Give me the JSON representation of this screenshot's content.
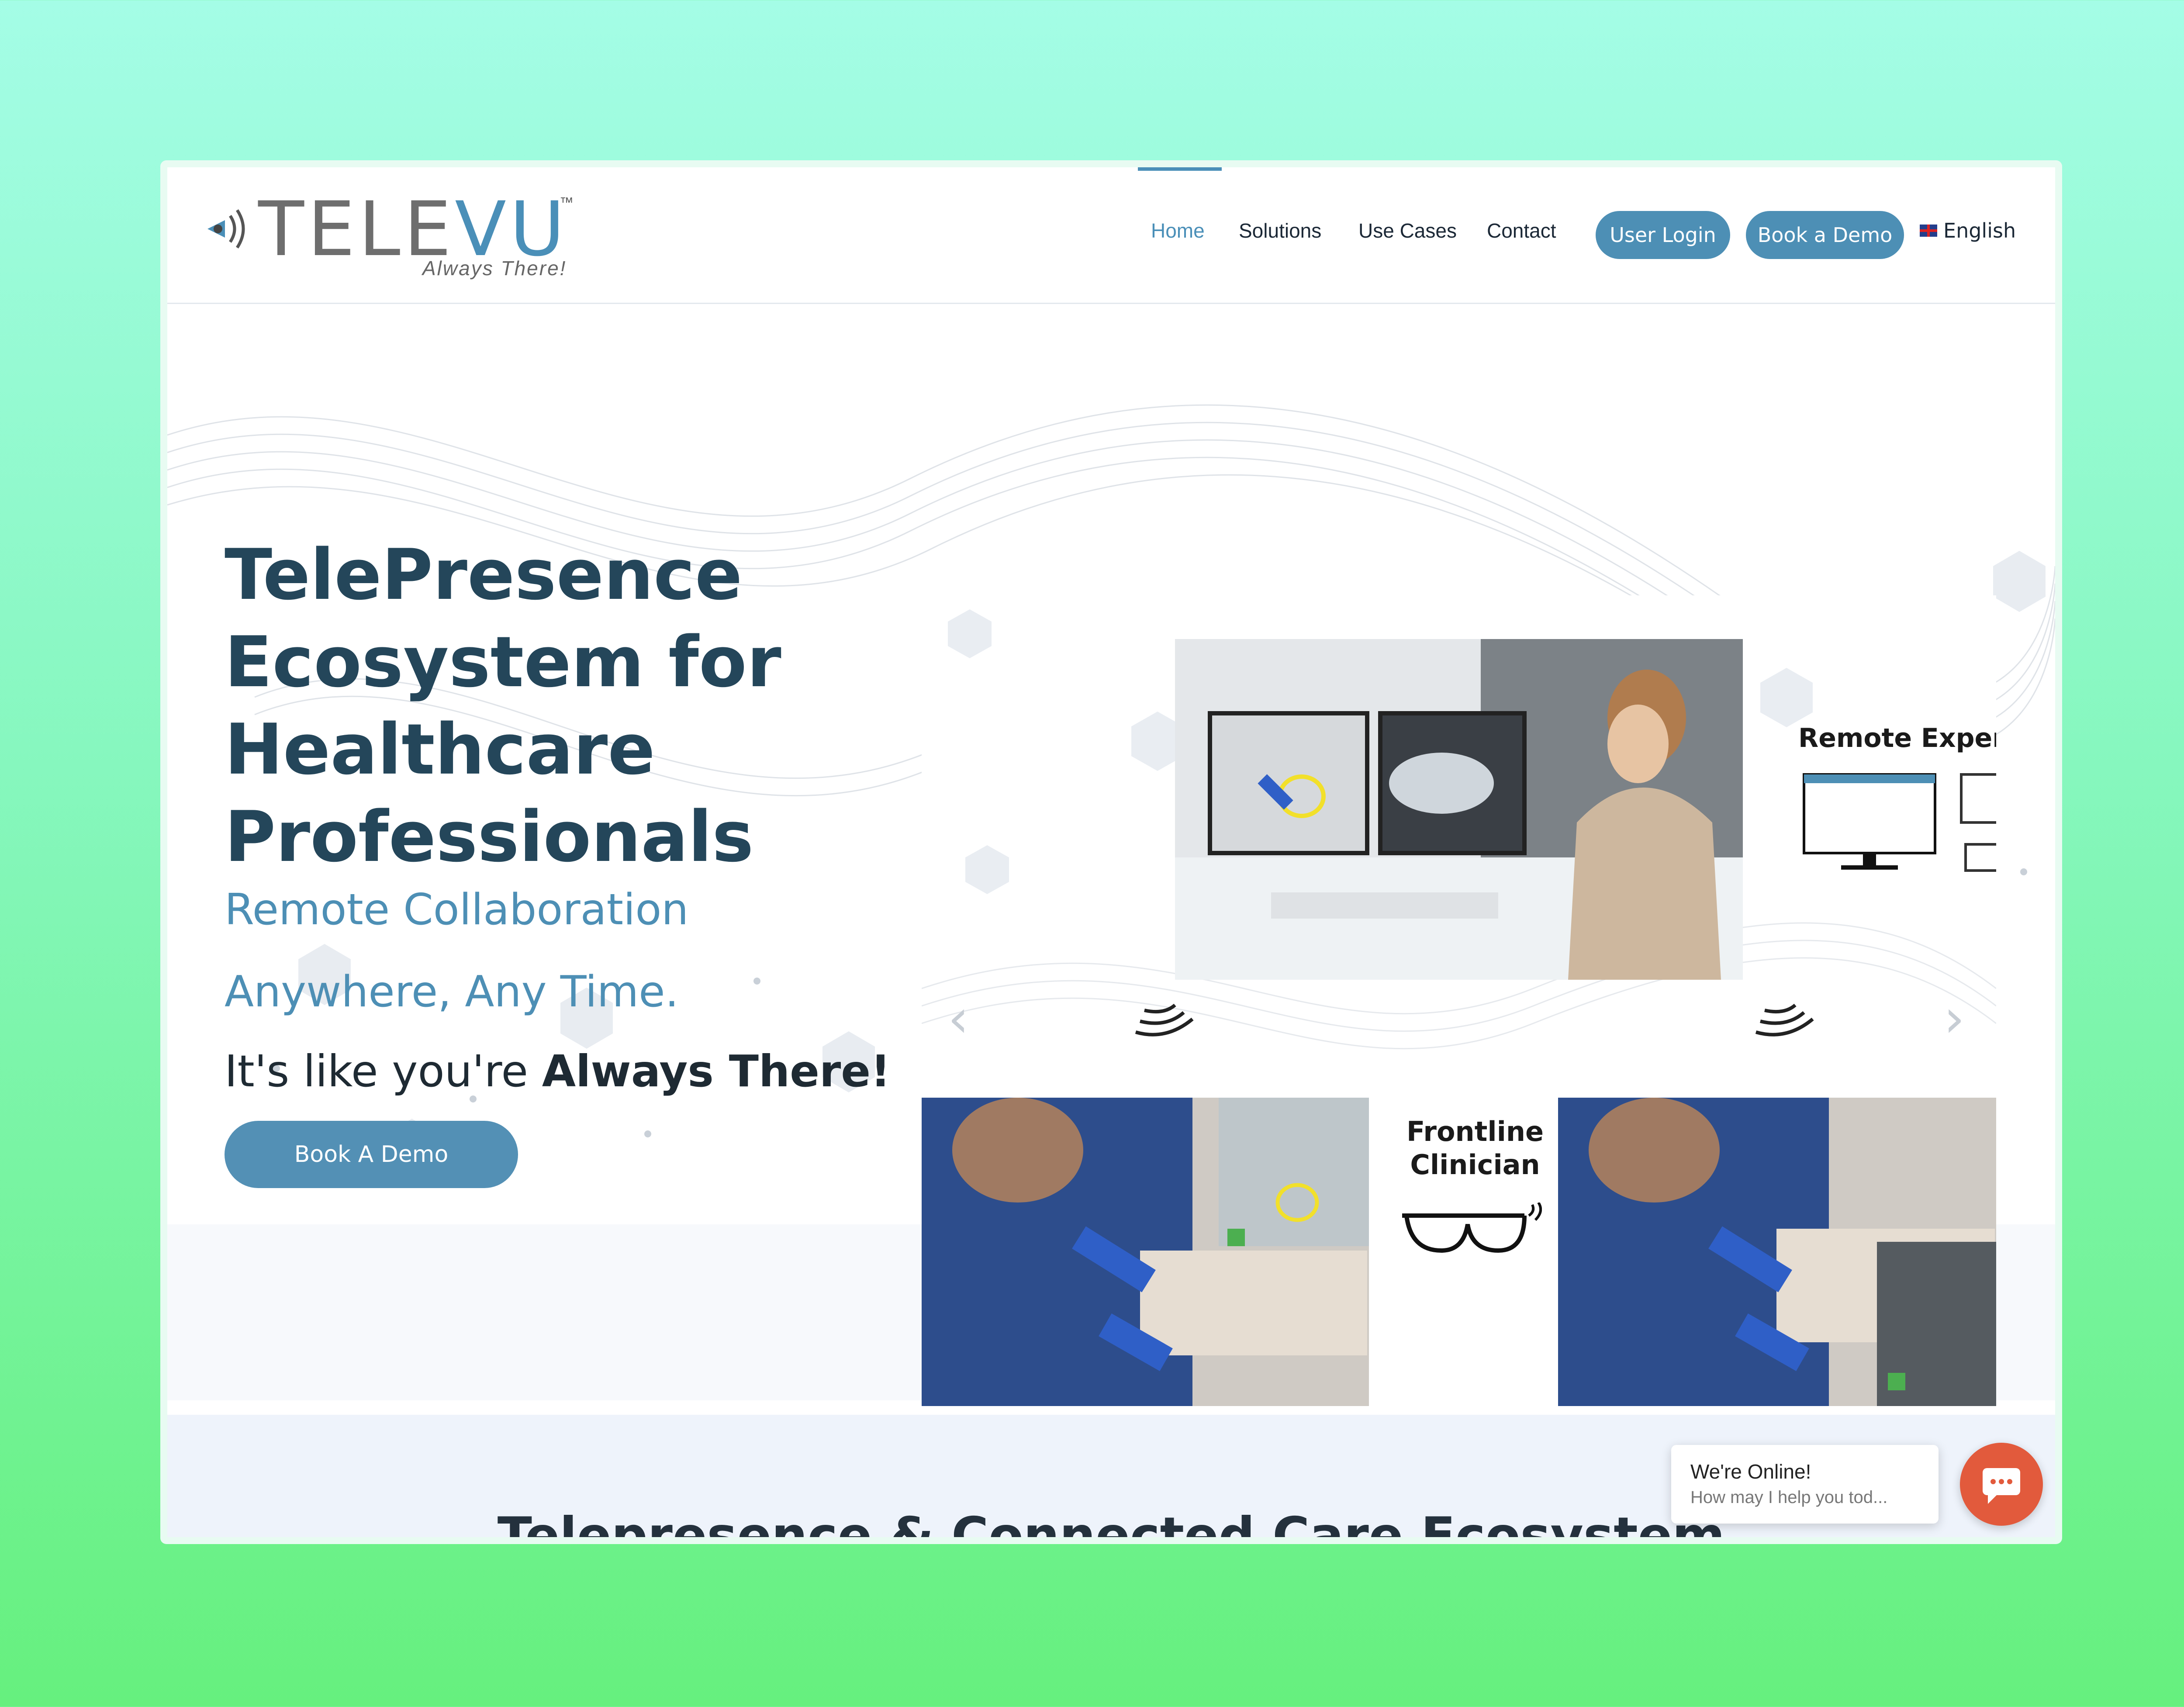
{
  "brand": {
    "word_gray": "TELE",
    "word_blue": "VU",
    "tm": "™",
    "tagline": "Always There!"
  },
  "nav": {
    "home": "Home",
    "solutions": "Solutions",
    "use_cases": "Use Cases",
    "contact": "Contact",
    "user_login": "User Login",
    "book_demo": "Book a Demo",
    "language": "English"
  },
  "hero": {
    "title_lines": [
      "TelePresence",
      "Ecosystem for",
      "Healthcare",
      "Professionals"
    ],
    "subtitle_1": "Remote Collaboration",
    "subtitle_2": "Anywhere, Any Time.",
    "tagline_prefix": "It's like you're ",
    "tagline_bold": "Always There!",
    "cta": "Book A Demo"
  },
  "slider": {
    "remote_label": "Remote Expert",
    "frontline_label_1": "Frontline",
    "frontline_label_2": "Clinician",
    "dots": [
      "#e8b93a",
      "#e8b93a",
      "#4d8fb5"
    ]
  },
  "section2": {
    "title": "Telepresence & Connected Care Ecosystem"
  },
  "chat": {
    "title": "We're Online!",
    "subtitle": "How may I help you tod..."
  },
  "colors": {
    "accent": "#4d8fb5",
    "heading": "#24465a",
    "chat": "#e25a3c"
  }
}
